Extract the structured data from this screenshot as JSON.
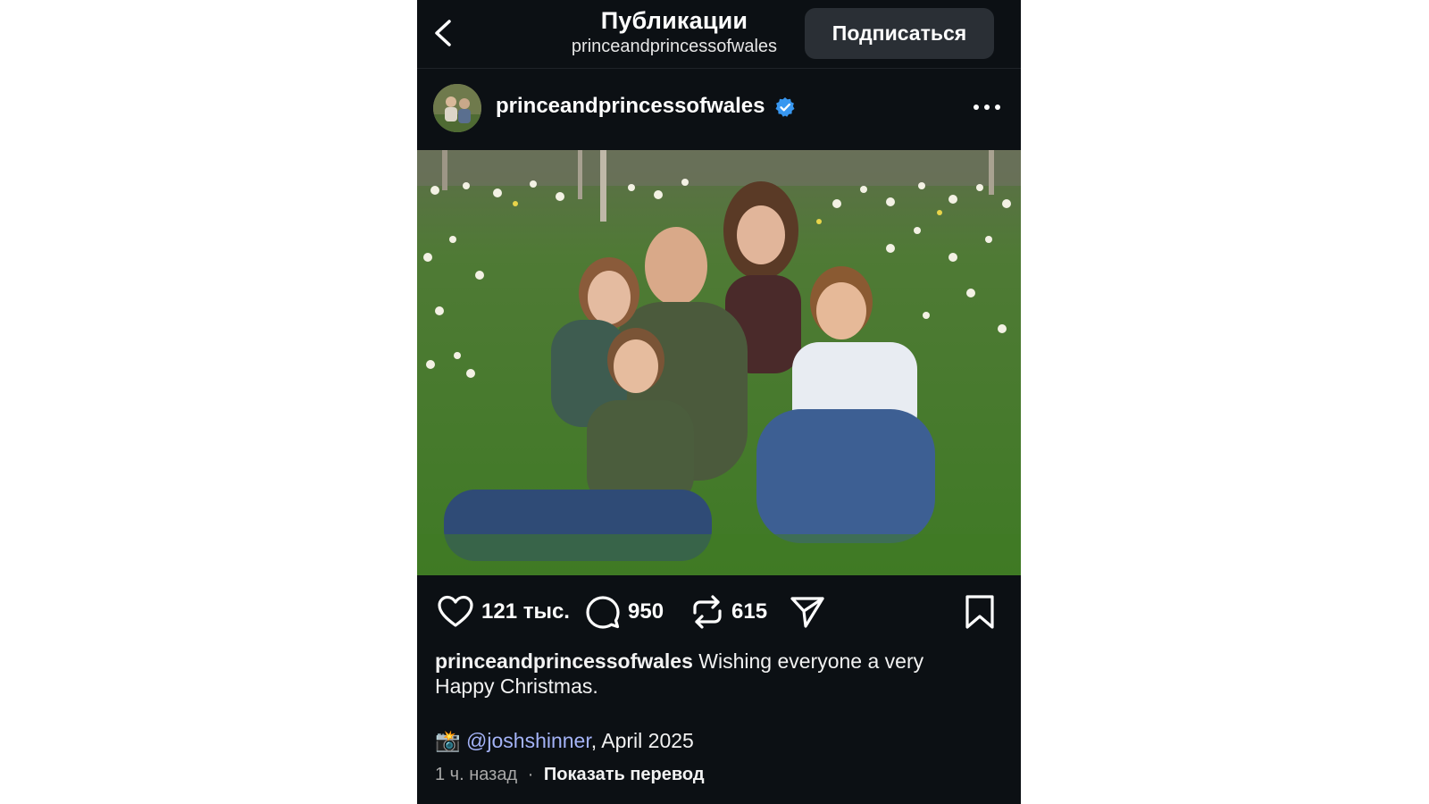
{
  "header": {
    "title": "Публикации",
    "subtitle": "princeandprincessofwales",
    "follow_label": "Подписаться"
  },
  "post": {
    "author": "princeandprincessofwales",
    "verified": true,
    "photo_description": "Family photo seated in a meadow of daffodils"
  },
  "actions": {
    "likes": "121 тыс.",
    "comments": "950",
    "reposts": "615"
  },
  "caption": {
    "username": "princeandprincessofwales",
    "text": " Wishing everyone a very Happy Christmas."
  },
  "credit": {
    "emoji": "📸",
    "mention": "@joshshinner",
    "suffix": ", April 2025"
  },
  "meta": {
    "time": "1 ч. назад",
    "separator": "·",
    "translate": "Показать перевод"
  },
  "colors": {
    "background": "#0c1014",
    "button": "#2a2f35",
    "mention": "#a4b3f7",
    "verified": "#3897f0"
  },
  "icons": [
    "back-icon",
    "verified-icon",
    "more-icon",
    "heart-icon",
    "comment-icon",
    "repost-icon",
    "share-icon",
    "bookmark-icon"
  ]
}
